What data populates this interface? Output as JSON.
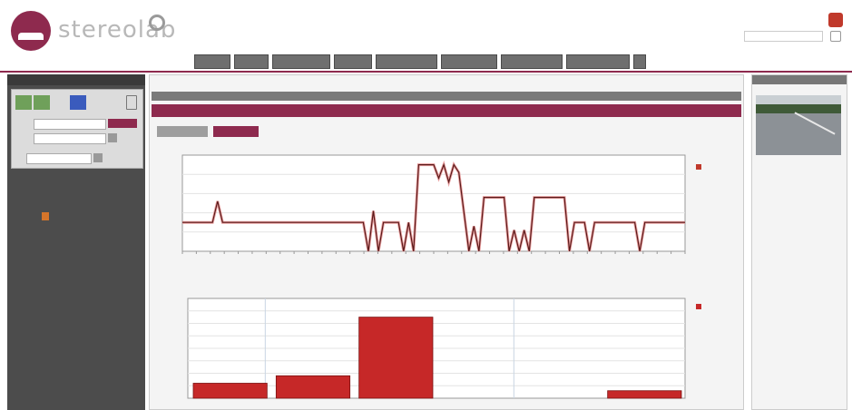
{
  "header": {
    "logo_text": "stereolab",
    "logo_sub": "",
    "user_name": "",
    "date_value": "",
    "nav_tabs": [
      "",
      "",
      "",
      "",
      "",
      "",
      "",
      "",
      ""
    ]
  },
  "sidebar": {
    "title": "",
    "from_label": "",
    "to_label": "",
    "unit_label": "",
    "apply_label": "",
    "tree": [
      "",
      "",
      ""
    ],
    "tree_selected": ""
  },
  "main": {
    "breadcrumb": "",
    "section_title": "",
    "subsection_title": "",
    "tabs": [
      "",
      ""
    ],
    "chart1_title": "",
    "chart2_title": ""
  },
  "right_panel": {
    "title": "",
    "info_lines": [
      "",
      "",
      "",
      "",
      "",
      "",
      ""
    ]
  },
  "colors": {
    "brand": "#8e2a4e",
    "series_line": "#c0392b",
    "bar_fill": "#c62828",
    "selected_tree_item": "#d5752a"
  },
  "chart_data": [
    {
      "type": "line",
      "title": "",
      "ylabel": "",
      "legend": "",
      "ylim": [
        0,
        5
      ],
      "x": [
        0,
        6,
        7,
        8,
        9,
        10,
        36,
        37,
        38,
        39,
        40,
        42,
        43,
        44,
        45,
        46,
        47,
        48,
        49,
        50,
        51,
        52,
        53,
        54,
        55,
        57,
        58,
        59,
        60,
        61,
        62,
        63,
        64,
        65,
        66,
        67,
        68,
        69,
        70,
        71,
        72,
        73,
        74,
        75,
        76,
        77,
        78,
        79,
        80,
        81,
        82,
        83,
        84,
        85,
        86,
        87,
        88,
        89,
        90,
        91,
        92,
        93,
        94,
        95,
        96,
        97,
        98,
        100
      ],
      "y": [
        1.5,
        1.5,
        2.6,
        1.5,
        1.5,
        1.5,
        1.5,
        0,
        2.1,
        0,
        1.5,
        1.5,
        1.5,
        0,
        1.5,
        0,
        4.5,
        4.5,
        4.5,
        4.5,
        3.8,
        4.5,
        3.6,
        4.5,
        4.1,
        0,
        1.3,
        0,
        2.8,
        2.8,
        2.8,
        2.8,
        2.8,
        0,
        1.1,
        0,
        1.1,
        0,
        2.8,
        2.8,
        2.8,
        2.8,
        2.8,
        2.8,
        2.8,
        0,
        1.5,
        1.5,
        1.5,
        0,
        1.5,
        1.5,
        1.5,
        1.5,
        1.5,
        1.5,
        1.5,
        1.5,
        1.5,
        0,
        1.5,
        1.5,
        1.5,
        1.5,
        1.5,
        1.5,
        1.5,
        1.5
      ],
      "x_tick_labels": [
        "",
        "",
        "",
        "",
        "",
        "",
        "",
        "",
        "",
        "",
        "",
        "",
        "",
        "",
        "",
        "",
        "",
        "",
        "",
        "",
        "",
        "",
        "",
        "",
        "",
        "",
        "",
        "",
        "",
        "",
        "",
        "",
        "",
        "",
        "",
        "",
        ""
      ]
    },
    {
      "type": "bar",
      "title": "",
      "ylabel": "",
      "legend": "",
      "ylim": [
        0,
        8
      ],
      "categories": [
        "",
        "",
        "",
        "",
        "",
        ""
      ],
      "values": [
        1.2,
        1.8,
        6.5,
        0,
        0,
        0.6
      ]
    }
  ]
}
